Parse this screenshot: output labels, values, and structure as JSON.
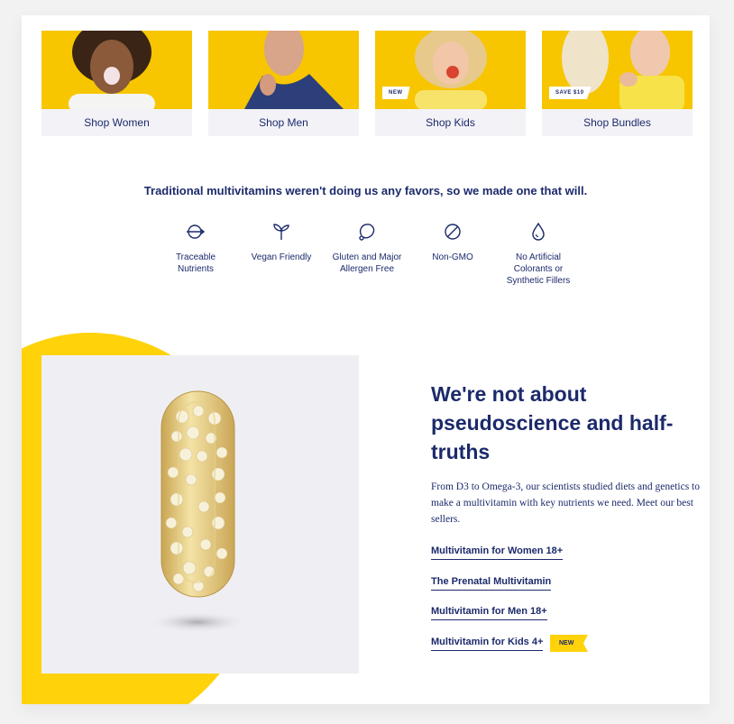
{
  "categories": [
    {
      "label": "Shop Women",
      "badge": ""
    },
    {
      "label": "Shop Men",
      "badge": ""
    },
    {
      "label": "Shop Kids",
      "badge": "NEW"
    },
    {
      "label": "Shop Bundles",
      "badge": "SAVE $10"
    }
  ],
  "headline": "Traditional multivitamins weren't doing us any favors, so we made one that will.",
  "features": [
    {
      "icon": "traceable-icon",
      "text": "Traceable\nNutrients"
    },
    {
      "icon": "sprout-icon",
      "text": "Vegan Friendly"
    },
    {
      "icon": "allergen-icon",
      "text": "Gluten and Major\nAllergen Free"
    },
    {
      "icon": "no-symbol-icon",
      "text": "Non-GMO"
    },
    {
      "icon": "droplet-icon",
      "text": "No Artificial\nColorants or\nSynthetic Fillers"
    }
  ],
  "promo": {
    "title": "We're not about pseudoscience and half-truths",
    "body": "From D3 to Omega-3, our scientists studied diets and genetics to make a multivitamin with key nutrients we need. Meet our best sellers.",
    "links": [
      "Multivitamin for Women 18+",
      "The Prenatal Multivitamin",
      "Multivitamin for Men 18+",
      "Multivitamin for Kids 4+"
    ],
    "new_tag": "NEW"
  },
  "colors": {
    "brand_yellow": "#ffd20a",
    "navy": "#1c2a6b",
    "panel_gray": "#efeff3"
  }
}
